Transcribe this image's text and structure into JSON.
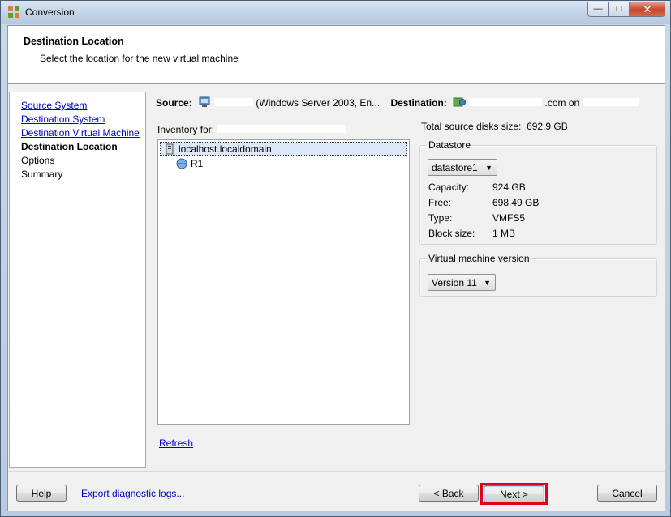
{
  "window": {
    "title": "Conversion"
  },
  "header": {
    "title": "Destination Location",
    "subtitle": "Select the location for the new virtual machine"
  },
  "nav": {
    "items": [
      {
        "label": "Source System",
        "state": "link"
      },
      {
        "label": "Destination System",
        "state": "link"
      },
      {
        "label": "Destination Virtual Machine",
        "state": "link"
      },
      {
        "label": "Destination Location",
        "state": "current"
      },
      {
        "label": "Options",
        "state": "plain"
      },
      {
        "label": "Summary",
        "state": "plain"
      }
    ]
  },
  "summary_bar": {
    "source_label": "Source:",
    "source_value": "(Windows Server 2003, En...",
    "destination_label": "Destination:",
    "destination_value": ".com on"
  },
  "inventory": {
    "label": "Inventory for:",
    "tree": [
      {
        "label": "localhost.localdomain",
        "icon": "host-icon",
        "selected": true
      },
      {
        "label": "R1",
        "icon": "resource-pool-icon",
        "selected": false
      }
    ],
    "refresh_label": "Refresh"
  },
  "details": {
    "total_source_disks_label": "Total source disks size:",
    "total_source_disks_value": "692.9 GB",
    "datastore": {
      "legend": "Datastore",
      "selected": "datastore1",
      "capacity_label": "Capacity:",
      "capacity_value": "924 GB",
      "free_label": "Free:",
      "free_value": "698.49 GB",
      "type_label": "Type:",
      "type_value": "VMFS5",
      "block_size_label": "Block size:",
      "block_size_value": "1 MB"
    },
    "vm_version": {
      "legend": "Virtual machine version",
      "selected": "Version 11"
    }
  },
  "footer": {
    "help_label": "Help",
    "export_label": "Export diagnostic logs...",
    "back_label": "< Back",
    "next_label": "Next >",
    "cancel_label": "Cancel"
  },
  "colors": {
    "link": "#0000cc",
    "highlight": "#e3001b"
  }
}
